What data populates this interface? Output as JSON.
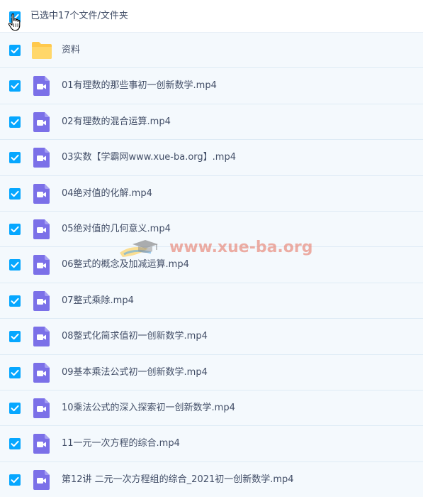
{
  "header": {
    "selection_label": "已选中17个文件/文件夹",
    "checked": true
  },
  "files": [
    {
      "type": "folder",
      "name": "资料"
    },
    {
      "type": "video",
      "name": "01有理数的那些事初一创新数学.mp4"
    },
    {
      "type": "video",
      "name": "02有理数的混合运算.mp4"
    },
    {
      "type": "video",
      "name": "03实数【学霸网www.xue-ba.org】.mp4"
    },
    {
      "type": "video",
      "name": "04绝对值的化解.mp4"
    },
    {
      "type": "video",
      "name": "05绝对值的几何意义.mp4"
    },
    {
      "type": "video",
      "name": "06整式的概念及加减运算.mp4"
    },
    {
      "type": "video",
      "name": "07整式乘除.mp4"
    },
    {
      "type": "video",
      "name": "08整式化简求值初一创新数学.mp4"
    },
    {
      "type": "video",
      "name": "09基本乘法公式初一创新数学.mp4"
    },
    {
      "type": "video",
      "name": "10乘法公式的深入探索初一创新数学.mp4"
    },
    {
      "type": "video",
      "name": "11一元一次方程的综合.mp4"
    },
    {
      "type": "video",
      "name": "第12讲 二元一次方程组的综合_2021初一创新数学.mp4"
    }
  ],
  "watermark": {
    "text": "www.xue-ba.org"
  },
  "colors": {
    "checkbox": "#06a7ff",
    "row_bg": "#f4f9fd",
    "folder": "#ffc94d",
    "video": "#7b70e8",
    "text": "#424e67"
  }
}
